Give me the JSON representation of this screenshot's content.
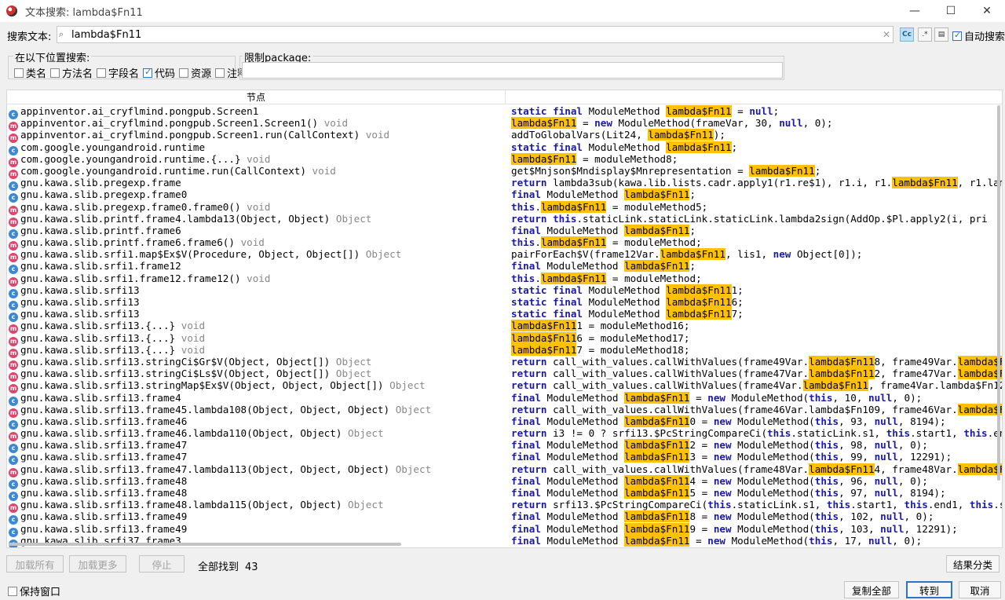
{
  "window": {
    "title": "文本搜索: lambda$Fn11",
    "minimize": "—",
    "maximize": "☐",
    "close": "✕"
  },
  "search": {
    "label": "搜索文本:",
    "value": "lambda$Fn11",
    "opt_case": "Cc",
    "opt_regex": ".*",
    "opt_word": "▤",
    "auto_search_label": "自动搜索",
    "auto_search_checked": true
  },
  "location": {
    "title": "在以下位置搜索:",
    "options": [
      {
        "label": "类名",
        "checked": false
      },
      {
        "label": "方法名",
        "checked": false
      },
      {
        "label": "字段名",
        "checked": false
      },
      {
        "label": "代码",
        "checked": true
      },
      {
        "label": "资源",
        "checked": false
      },
      {
        "label": "注释",
        "checked": false
      }
    ]
  },
  "package_filter": {
    "title": "限制package:",
    "value": ""
  },
  "table": {
    "col_node": "节点",
    "col_code": "",
    "rows": [
      {
        "icon": "c",
        "node": "appinventor.ai_cryflmind.pongpub.Screen1",
        "type": "",
        "code": "<k>static</k> <k>final</k> ModuleMethod <h>lambda$Fn11</h> = <k>null</k>;"
      },
      {
        "icon": "m",
        "node": "appinventor.ai_cryflmind.pongpub.Screen1.Screen1()",
        "type": "void",
        "code": "<h>lambda$Fn11</h> = <k>new</k> ModuleMethod(frameVar, 30, <k>null</k>, 0);"
      },
      {
        "icon": "m",
        "node": "appinventor.ai_cryflmind.pongpub.Screen1.run(CallContext)",
        "type": "void",
        "code": "addToGlobalVars(Lit24, <h>lambda$Fn11</h>);"
      },
      {
        "icon": "c",
        "node": "com.google.youngandroid.runtime",
        "type": "",
        "code": "<k>static</k> <k>final</k> ModuleMethod <h>lambda$Fn11</h>;"
      },
      {
        "icon": "m",
        "node": "com.google.youngandroid.runtime.{...}",
        "type": "void",
        "code": "<h>lambda$Fn11</h> = moduleMethod8;"
      },
      {
        "icon": "m",
        "node": "com.google.youngandroid.runtime.run(CallContext)",
        "type": "void",
        "code": "get$Mnjson$Mndisplay$Mnrepresentation = <h>lambda$Fn11</h>;"
      },
      {
        "icon": "c",
        "node": "gnu.kawa.slib.pregexp.frame",
        "type": "",
        "code": "<k>return</k> lambda3sub(kawa.lib.lists.cadr.apply1(r1.re$1), r1.i, r1.<h>lambda$Fn11</h>, r1.lambda$Fn1"
      },
      {
        "icon": "c",
        "node": "gnu.kawa.slib.pregexp.frame0",
        "type": "",
        "code": "<k>final</k> ModuleMethod <h>lambda$Fn11</h>;"
      },
      {
        "icon": "m",
        "node": "gnu.kawa.slib.pregexp.frame0.frame0()",
        "type": "void",
        "code": "<k>this</k>.<h>lambda$Fn11</h> = moduleMethod5;"
      },
      {
        "icon": "m",
        "node": "gnu.kawa.slib.printf.frame4.lambda13(Object, Object)",
        "type": "Object",
        "code": "<k>return</k> <k>this</k>.staticLink.staticLink.staticLink.lambda2sign(AddOp.$Pl.apply2(i, pri"
      },
      {
        "icon": "c",
        "node": "gnu.kawa.slib.printf.frame6",
        "type": "",
        "code": "<k>final</k> ModuleMethod <h>lambda$Fn11</h>;"
      },
      {
        "icon": "m",
        "node": "gnu.kawa.slib.printf.frame6.frame6()",
        "type": "void",
        "code": "<k>this</k>.<h>lambda$Fn11</h> = moduleMethod;"
      },
      {
        "icon": "m",
        "node": "gnu.kawa.slib.srfi1.map$Ex$V(Procedure, Object, Object[])",
        "type": "Object",
        "code": "pairForEach$V(frame12Var.<h>lambda$Fn11</h>, lis1, <k>new</k> Object[0]);"
      },
      {
        "icon": "c",
        "node": "gnu.kawa.slib.srfi1.frame12",
        "type": "",
        "code": "<k>final</k> ModuleMethod <h>lambda$Fn11</h>;"
      },
      {
        "icon": "m",
        "node": "gnu.kawa.slib.srfi1.frame12.frame12()",
        "type": "void",
        "code": "<k>this</k>.<h>lambda$Fn11</h> = moduleMethod;"
      },
      {
        "icon": "c",
        "node": "gnu.kawa.slib.srfi13",
        "type": "",
        "code": "<k>static</k> <k>final</k> ModuleMethod <h>lambda$Fn11</h>1;"
      },
      {
        "icon": "c",
        "node": "gnu.kawa.slib.srfi13",
        "type": "",
        "code": "<k>static</k> <k>final</k> ModuleMethod <h>lambda$Fn11</h>6;"
      },
      {
        "icon": "c",
        "node": "gnu.kawa.slib.srfi13",
        "type": "",
        "code": "<k>static</k> <k>final</k> ModuleMethod <h>lambda$Fn11</h>7;"
      },
      {
        "icon": "m",
        "node": "gnu.kawa.slib.srfi13.{...}",
        "type": "void",
        "code": "<h>lambda$Fn11</h>1 = moduleMethod16;"
      },
      {
        "icon": "m",
        "node": "gnu.kawa.slib.srfi13.{...}",
        "type": "void",
        "code": "<h>lambda$Fn11</h>6 = moduleMethod17;"
      },
      {
        "icon": "m",
        "node": "gnu.kawa.slib.srfi13.{...}",
        "type": "void",
        "code": "<h>lambda$Fn11</h>7 = moduleMethod18;"
      },
      {
        "icon": "m",
        "node": "gnu.kawa.slib.srfi13.stringCi$Gr$V(Object, Object[])",
        "type": "Object",
        "code": "<k>return</k> call_with_values.callWithValues(frame49Var.<h>lambda$Fn11</h>8, frame49Var.<h>lambda$Fn11</h>"
      },
      {
        "icon": "m",
        "node": "gnu.kawa.slib.srfi13.stringCi$Ls$V(Object, Object[])",
        "type": "Object",
        "code": "<k>return</k> call_with_values.callWithValues(frame47Var.<h>lambda$Fn11</h>2, frame47Var.<h>lambda$Fn11</h>"
      },
      {
        "icon": "m",
        "node": "gnu.kawa.slib.srfi13.stringMap$Ex$V(Object, Object, Object[])",
        "type": "Object",
        "code": "<k>return</k> call_with_values.callWithValues(frame4Var.<h>lambda$Fn11</h>, frame4Var.lambda$Fn12"
      },
      {
        "icon": "c",
        "node": "gnu.kawa.slib.srfi13.frame4",
        "type": "",
        "code": "<k>final</k> ModuleMethod <h>lambda$Fn11</h> = <k>new</k> ModuleMethod(<k>this</k>, 10, <k>null</k>, 0);"
      },
      {
        "icon": "m",
        "node": "gnu.kawa.slib.srfi13.frame45.lambda108(Object, Object, Object)",
        "type": "Object",
        "code": "<k>return</k> call_with_values.callWithValues(frame46Var.lambda$Fn109, frame46Var.<h>lambda$Fn11</h>"
      },
      {
        "icon": "c",
        "node": "gnu.kawa.slib.srfi13.frame46",
        "type": "",
        "code": "<k>final</k> ModuleMethod <h>lambda$Fn11</h>0 = <k>new</k> ModuleMethod(<k>this</k>, 93, <k>null</k>, 8194);"
      },
      {
        "icon": "m",
        "node": "gnu.kawa.slib.srfi13.frame46.lambda110(Object, Object)",
        "type": "Object",
        "code": "<k>return</k> i3 != 0 ? srfi13.$PcStringCompareCi(<k>this</k>.staticLink.s1, <k>this</k>.start1, <k>this</k>.end1"
      },
      {
        "icon": "c",
        "node": "gnu.kawa.slib.srfi13.frame47",
        "type": "",
        "code": "<k>final</k> ModuleMethod <h>lambda$Fn11</h>2 = <k>new</k> ModuleMethod(<k>this</k>, 98, <k>null</k>, 0);"
      },
      {
        "icon": "c",
        "node": "gnu.kawa.slib.srfi13.frame47",
        "type": "",
        "code": "<k>final</k> ModuleMethod <h>lambda$Fn11</h>3 = <k>new</k> ModuleMethod(<k>this</k>, 99, <k>null</k>, 12291);"
      },
      {
        "icon": "m",
        "node": "gnu.kawa.slib.srfi13.frame47.lambda113(Object, Object, Object)",
        "type": "Object",
        "code": "<k>return</k> call_with_values.callWithValues(frame48Var.<h>lambda$Fn11</h>4, frame48Var.<h>lambda$Fn11</h>"
      },
      {
        "icon": "c",
        "node": "gnu.kawa.slib.srfi13.frame48",
        "type": "",
        "code": "<k>final</k> ModuleMethod <h>lambda$Fn11</h>4 = <k>new</k> ModuleMethod(<k>this</k>, 96, <k>null</k>, 0);"
      },
      {
        "icon": "c",
        "node": "gnu.kawa.slib.srfi13.frame48",
        "type": "",
        "code": "<k>final</k> ModuleMethod <h>lambda$Fn11</h>5 = <k>new</k> ModuleMethod(<k>this</k>, 97, <k>null</k>, 8194);"
      },
      {
        "icon": "m",
        "node": "gnu.kawa.slib.srfi13.frame48.lambda115(Object, Object)",
        "type": "Object",
        "code": "<k>return</k> srfi13.$PcStringCompareCi(<k>this</k>.staticLink.s1, <k>this</k>.start1, <k>this</k>.end1, <k>this</k>.s"
      },
      {
        "icon": "c",
        "node": "gnu.kawa.slib.srfi13.frame49",
        "type": "",
        "code": "<k>final</k> ModuleMethod <h>lambda$Fn11</h>8 = <k>new</k> ModuleMethod(<k>this</k>, 102, <k>null</k>, 0);"
      },
      {
        "icon": "c",
        "node": "gnu.kawa.slib.srfi13.frame49",
        "type": "",
        "code": "<k>final</k> ModuleMethod <h>lambda$Fn11</h>9 = <k>new</k> ModuleMethod(<k>this</k>, 103, <k>null</k>, 12291);"
      },
      {
        "icon": "c",
        "node": "gnu.kawa.slib.srfi37.frame3",
        "type": "",
        "code": "<k>final</k> ModuleMethod <h>lambda$Fn11</h> = <k>new</k> ModuleMethod(<k>this</k>, 17, <k>null</k>, 0);"
      }
    ]
  },
  "footer": {
    "load_all": "加载所有",
    "load_more": "加载更多",
    "stop": "停止",
    "found_label": "全部找到",
    "found_count": "43",
    "group_results": "结果分类",
    "keep_window": "保持窗口",
    "copy_all": "复制全部",
    "goto": "转到",
    "cancel": "取消"
  },
  "colors": {
    "highlight": "#ffc107",
    "keyword": "#1a1aa6",
    "primary_border": "#2b74c7"
  }
}
